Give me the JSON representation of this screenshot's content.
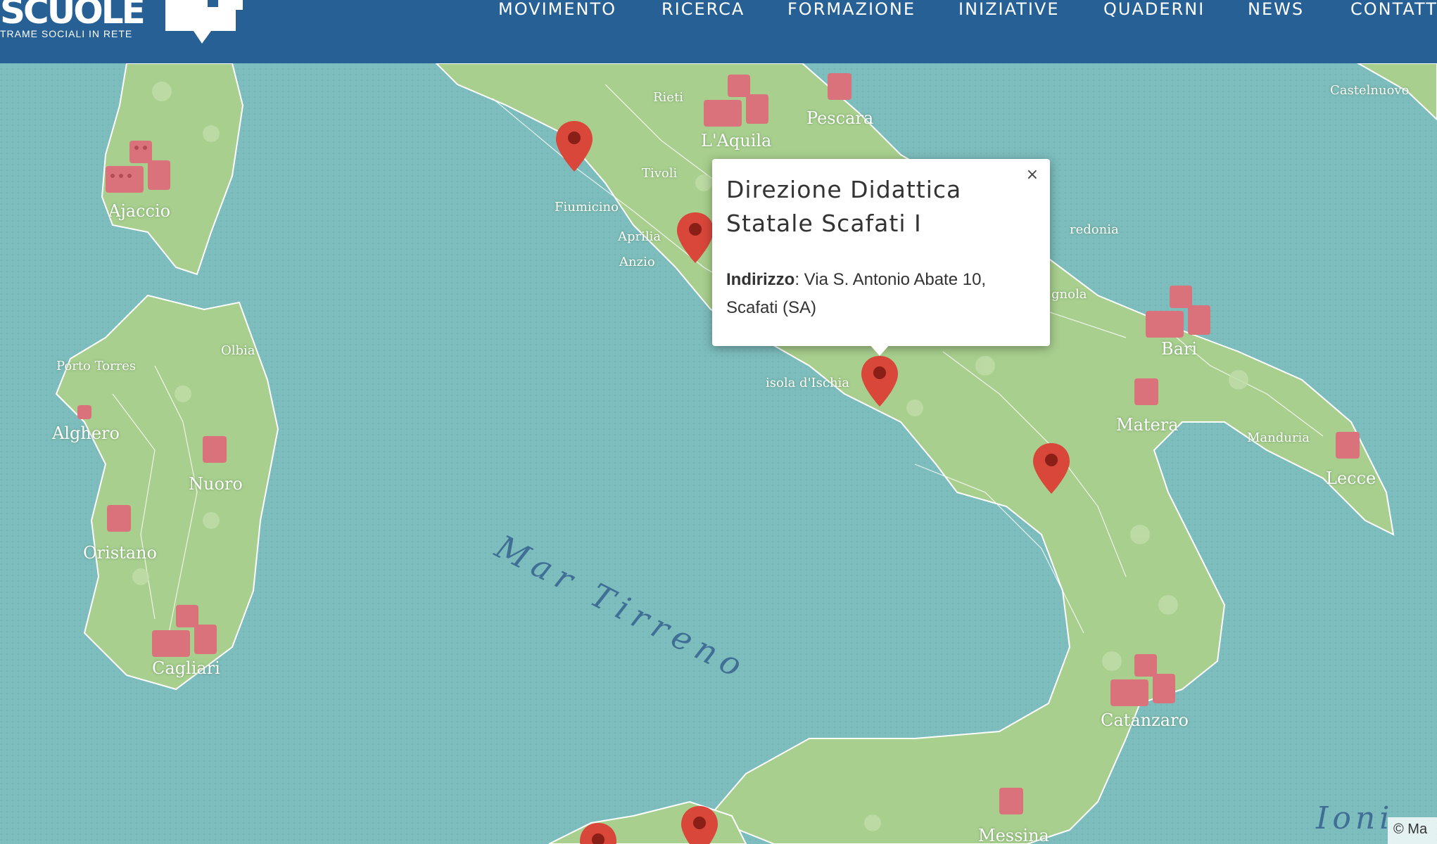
{
  "header": {
    "logo_word": "SCUOLE",
    "logo_tagline": "TRAME SOCIALI IN RETE",
    "nav": [
      "MOVIMENTO",
      "RICERCA",
      "FORMAZIONE",
      "INIZIATIVE",
      "QUADERNI",
      "NEWS",
      "CONTATTI"
    ]
  },
  "map": {
    "sea_labels": [
      "Mar Tirreno",
      "Ioni"
    ],
    "cities": {
      "ajaccio": "Ajaccio",
      "porto_torres": "Porto Torres",
      "olbia": "Olbia",
      "alghero": "Alghero",
      "nuoro": "Nuoro",
      "oristano": "Oristano",
      "cagliari": "Cagliari",
      "rieti": "Rieti",
      "laquila": "L'Aquila",
      "pescara": "Pescara",
      "tivoli": "Tivoli",
      "fiumicino": "Fiumicino",
      "aprilia": "Aprilia",
      "anzio": "Anzio",
      "ischia": "isola d'Ischia",
      "manfredonia": "redonia",
      "cerignola": "gnola",
      "bari": "Bari",
      "matera": "Matera",
      "manduria": "Manduria",
      "lecce": "Lecce",
      "catanzaro": "Catanzaro",
      "messina": "Messina",
      "castelnuovo": "Castelnuovo"
    },
    "attribution": "© Ma"
  },
  "popup": {
    "title": "Direzione Didattica Statale Scafati I",
    "address_label": "Indirizzo",
    "address_value": ": Via S. Antonio Abate 10, Scafati (SA)",
    "close_symbol": "×"
  },
  "colors": {
    "header_bg": "#276095",
    "sea": "#7dbdbd",
    "land": "#a8cf8e",
    "marker": "#d9463a",
    "school_icon": "#d9727a"
  }
}
